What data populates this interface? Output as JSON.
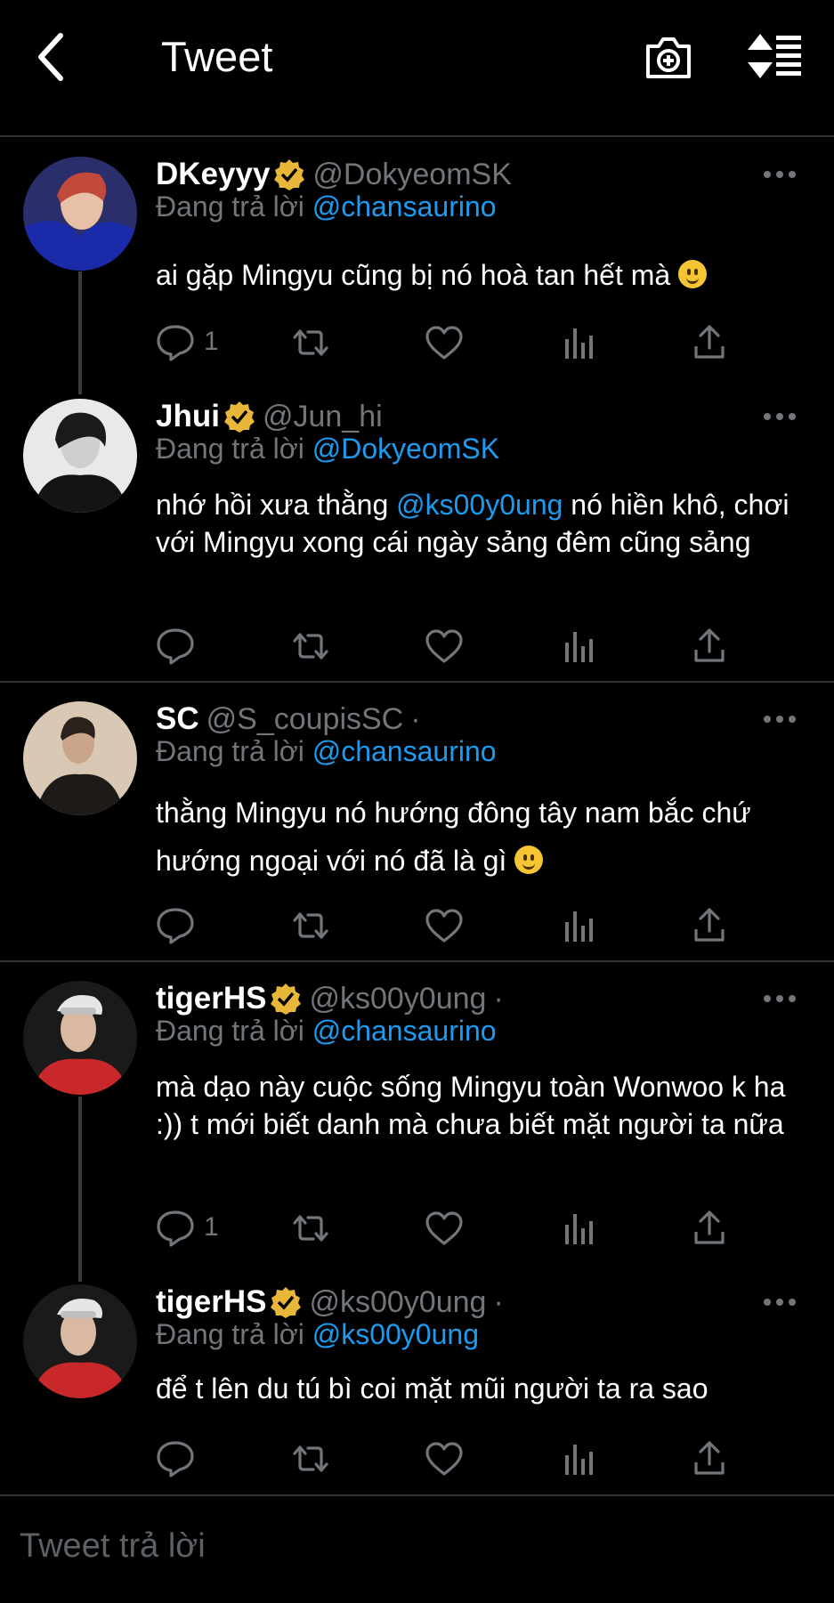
{
  "header": {
    "title": "Tweet"
  },
  "reply_prefix": "Đang trả lời",
  "tweets": [
    {
      "name": "DKeyyy",
      "verified": true,
      "handle": "@DokyeomSK",
      "meta": "",
      "reply_to": "@chansaurino",
      "text_before": "ai gặp Mingyu cũng bị nó hoà tan hết mà ",
      "mention": "",
      "text_after": "",
      "emoji": true,
      "reply_count": "1"
    },
    {
      "name": "Jhui",
      "verified": true,
      "handle": "@Jun_hi",
      "meta": "",
      "reply_to": "@DokyeomSK",
      "text_before": "nhớ hồi xưa thằng ",
      "mention": "@ks00y0ung",
      "text_after": " nó hiền khô, chơi với Mingyu xong cái ngày sảng đêm cũng sảng",
      "emoji": false,
      "reply_count": ""
    },
    {
      "name": "SC",
      "verified": false,
      "handle": "@S_coupisSC",
      "meta": "·",
      "reply_to": "@chansaurino",
      "text_before": "thằng Mingyu nó hướng đông tây nam bắc chứ hướng ngoại với nó đã là gì ",
      "mention": "",
      "text_after": "",
      "emoji": true,
      "reply_count": ""
    },
    {
      "name": "tigerHS",
      "verified": true,
      "handle": "@ks00y0ung",
      "meta": "·",
      "reply_to": "@chansaurino",
      "text_before": "mà dạo này cuộc sống Mingyu toàn Wonwoo k ha :)) t mới biết danh mà chưa biết mặt người ta nữa",
      "mention": "",
      "text_after": "",
      "emoji": false,
      "reply_count": "1"
    },
    {
      "name": "tigerHS",
      "verified": true,
      "handle": "@ks00y0ung",
      "meta": "·",
      "reply_to": "@ks00y0ung",
      "text_before": "để t lên du tú bì coi mặt mũi người ta ra sao",
      "mention": "",
      "text_after": "",
      "emoji": false,
      "reply_count": ""
    }
  ],
  "compose": {
    "placeholder": "Tweet trả lời"
  },
  "colors": {
    "background": "#000000",
    "accent": "#1d9bf0",
    "muted": "#71767b",
    "verified": "#e8b73a",
    "divider": "#2f3336"
  }
}
